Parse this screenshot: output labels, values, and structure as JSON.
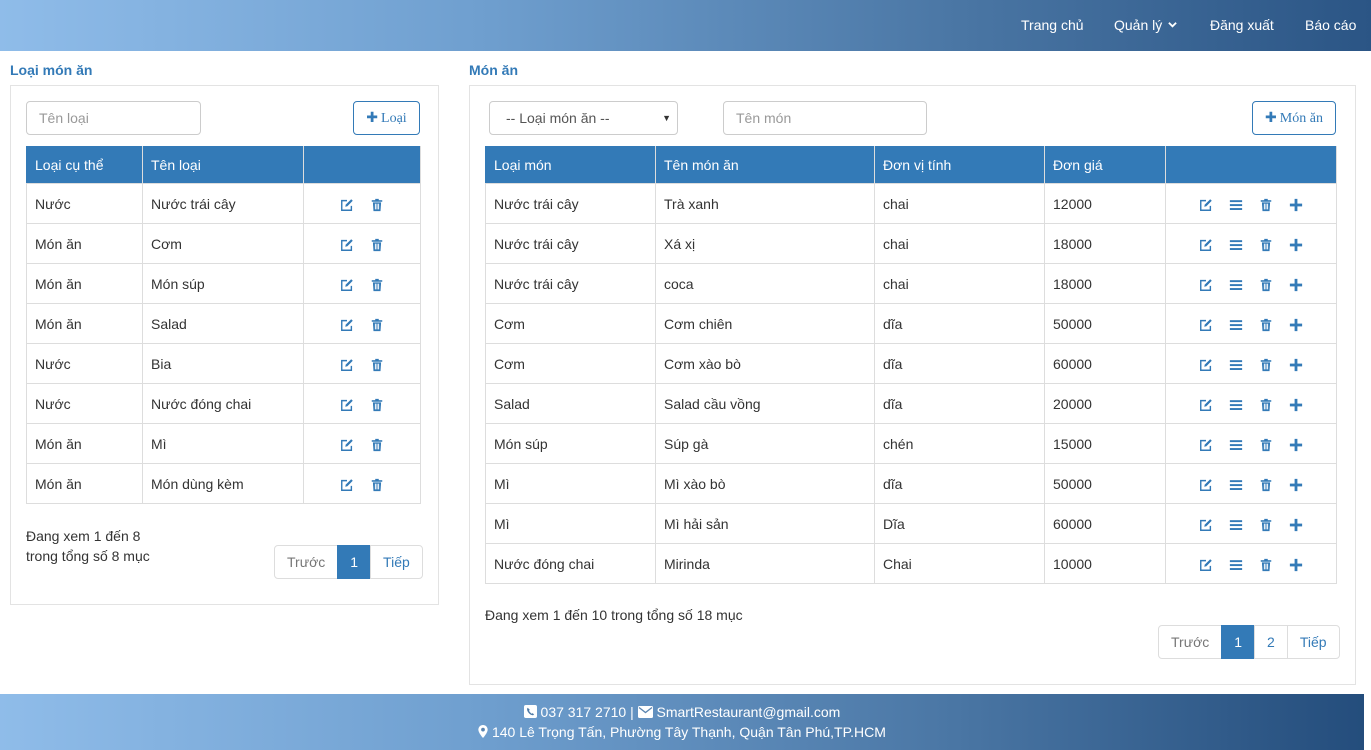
{
  "nav": {
    "home": "Trang chủ",
    "manage": "Quản lý",
    "logout": "Đăng xuất",
    "report": "Báo cáo"
  },
  "categories": {
    "title": "Loại món ăn",
    "name_placeholder": "Tên loại",
    "add_label": "Loại",
    "columns": [
      "Loại cụ thể",
      "Tên loại",
      ""
    ],
    "rows": [
      [
        "Nước",
        "Nước trái cây"
      ],
      [
        "Món ăn",
        "Cơm"
      ],
      [
        "Món ăn",
        "Món súp"
      ],
      [
        "Món ăn",
        "Salad"
      ],
      [
        "Nước",
        "Bia"
      ],
      [
        "Nước",
        "Nước đóng chai"
      ],
      [
        "Món ăn",
        "Mì"
      ],
      [
        "Món ăn",
        "Món dùng kèm"
      ]
    ],
    "info_line1": "Đang xem 1 đến 8",
    "info_line2": "trong tổng số 8 mục",
    "pager": {
      "prev": "Trước",
      "pages": [
        "1"
      ],
      "next": "Tiếp"
    }
  },
  "dishes": {
    "title": "Món ăn",
    "filter_selected": "-- Loại món ăn --",
    "name_placeholder": "Tên món",
    "add_label": "Món ăn",
    "columns": [
      "Loại món",
      "Tên món ăn",
      "Đơn vị tính",
      "Đơn giá",
      ""
    ],
    "rows": [
      [
        "Nước trái cây",
        "Trà xanh",
        "chai",
        "12000"
      ],
      [
        "Nước trái cây",
        "Xá xị",
        "chai",
        "18000"
      ],
      [
        "Nước trái cây",
        "coca",
        "chai",
        "18000"
      ],
      [
        "Cơm",
        "Cơm chiên",
        "dĩa",
        "50000"
      ],
      [
        "Cơm",
        "Cơm xào bò",
        "dĩa",
        "60000"
      ],
      [
        "Salad",
        "Salad cầu vồng",
        "dĩa",
        "20000"
      ],
      [
        "Món súp",
        "Súp gà",
        "chén",
        "15000"
      ],
      [
        "Mì",
        "Mì xào bò",
        "dĩa",
        "50000"
      ],
      [
        "Mì",
        "Mì hải sản",
        "Dĩa",
        "60000"
      ],
      [
        "Nước đóng chai",
        "Mirinda",
        "Chai",
        "10000"
      ]
    ],
    "info": "Đang xem 1 đến 10 trong tổng số 18 mục",
    "pager": {
      "prev": "Trước",
      "pages": [
        "1",
        "2"
      ],
      "next": "Tiếp"
    }
  },
  "footer": {
    "phone": "037 317 2710",
    "separator": "|",
    "email": "SmartRestaurant@gmail.com",
    "address": "140 Lê Trọng Tấn, Phường Tây Thạnh, Quận Tân Phú,TP.HCM"
  },
  "colors": {
    "primary": "#337ab7",
    "border": "#dddddd"
  },
  "icons": {
    "edit": "edit-icon",
    "list": "list-icon",
    "delete": "trash-icon",
    "add": "plus-icon",
    "phone": "phone-icon",
    "mail": "envelope-icon",
    "location": "map-marker-icon"
  }
}
